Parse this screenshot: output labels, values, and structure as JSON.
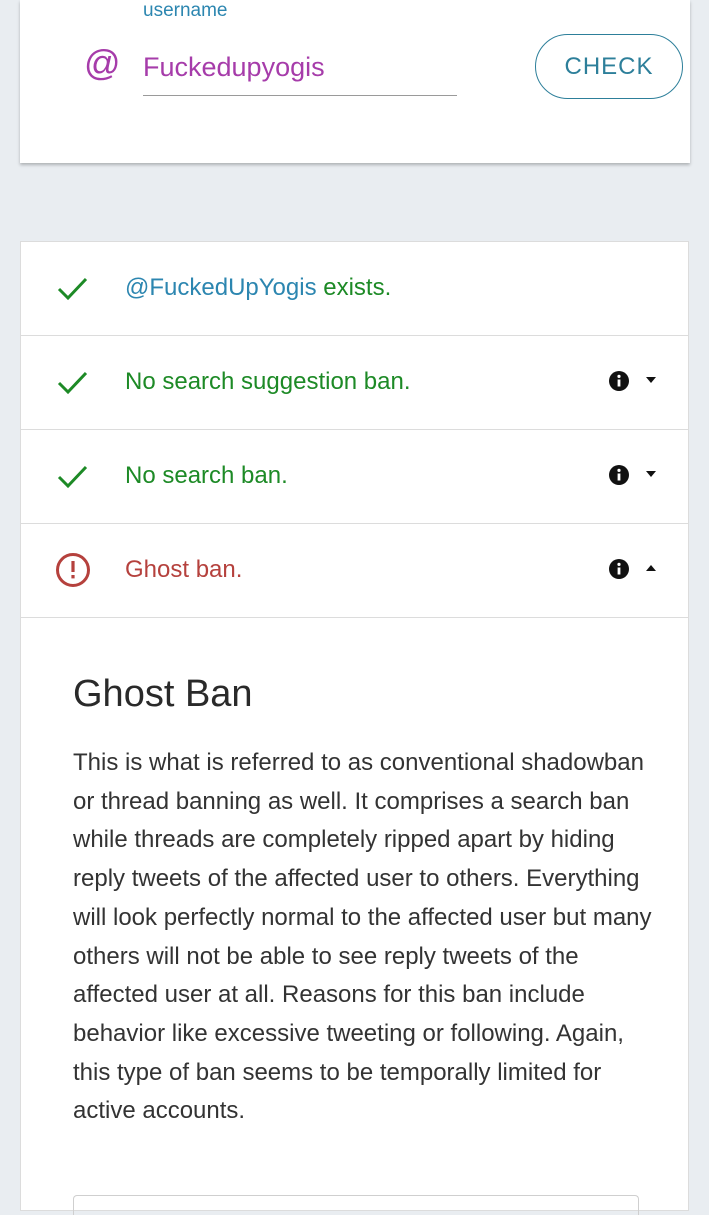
{
  "search": {
    "field_label": "username",
    "at_symbol": "@",
    "input_value": "Fuckedupyogis",
    "check_label": "CHECK"
  },
  "results": {
    "exists": {
      "handle": "@FuckedUpYogis",
      "text": " exists.",
      "status": "ok"
    },
    "suggestion_ban": {
      "text": "No search suggestion ban.",
      "status": "ok",
      "expanded": false
    },
    "search_ban": {
      "text": "No search ban.",
      "status": "ok",
      "expanded": false
    },
    "ghost_ban": {
      "text": "Ghost ban.",
      "status": "banned",
      "expanded": true
    }
  },
  "detail": {
    "title": "Ghost Ban",
    "body": "This is what is referred to as conventional shadowban or thread banning as well. It comprises a search ban while threads are completely ripped apart by hiding reply tweets of the affected user to others. Everything will look perfectly normal to the affected user but many others will not be able to see reply tweets of the affected user at all. Reasons for this ban include behavior like excessive tweeting or following. Again, this type of ban seems to be temporally limited for active accounts."
  },
  "colors": {
    "ok": "#1d8a26",
    "banned": "#b5413d",
    "accent": "#2c86b0",
    "username": "#a63caa"
  },
  "icons": {
    "ok": "check-icon",
    "banned": "alert-circle-icon",
    "info": "info-icon",
    "collapsed": "caret-down-icon",
    "expanded": "caret-up-icon"
  }
}
